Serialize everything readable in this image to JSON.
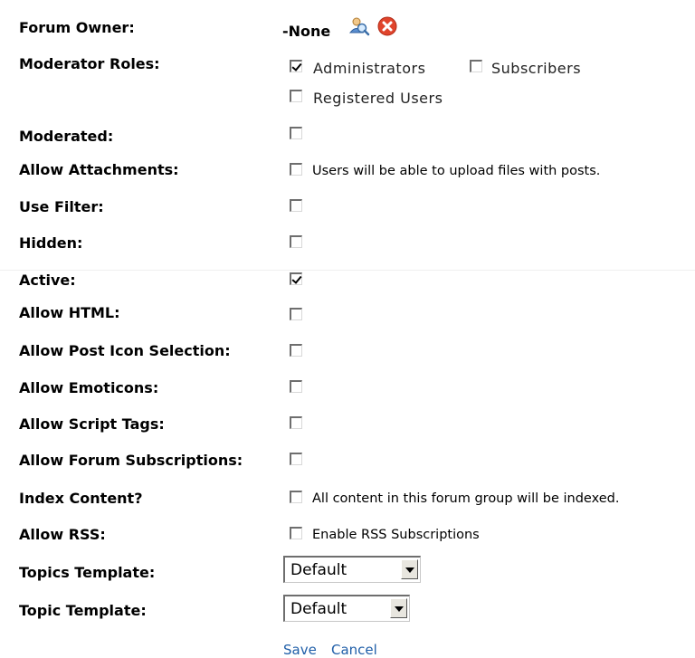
{
  "form": {
    "forum_owner": {
      "label": "Forum Owner:",
      "value": "-None"
    },
    "moderator_roles": {
      "label": "Moderator Roles:",
      "options": [
        {
          "label": "Administrators",
          "checked": true
        },
        {
          "label": "Subscribers",
          "checked": false
        },
        {
          "label": "Registered Users",
          "checked": false
        }
      ]
    },
    "moderated": {
      "label": "Moderated:",
      "checked": false
    },
    "allow_attachments": {
      "label": "Allow Attachments:",
      "checked": false,
      "description": "Users will be able to upload files with posts."
    },
    "use_filter": {
      "label": "Use Filter:",
      "checked": false
    },
    "hidden": {
      "label": "Hidden:",
      "checked": false
    },
    "active": {
      "label": "Active:",
      "checked": true
    },
    "allow_html": {
      "label": "Allow HTML:",
      "checked": false
    },
    "allow_post_icon_selection": {
      "label": "Allow Post Icon Selection:",
      "checked": false
    },
    "allow_emoticons": {
      "label": "Allow Emoticons:",
      "checked": false
    },
    "allow_script_tags": {
      "label": "Allow Script Tags:",
      "checked": false
    },
    "allow_forum_subscriptions": {
      "label": "Allow Forum Subscriptions:",
      "checked": false
    },
    "index_content": {
      "label": "Index Content?",
      "checked": false,
      "description": "All content in this forum group will be indexed."
    },
    "allow_rss": {
      "label": "Allow RSS:",
      "checked": false,
      "description": "Enable RSS Subscriptions"
    },
    "topics_template": {
      "label": "Topics Template:",
      "selected": "Default"
    },
    "topic_template": {
      "label": "Topic Template:",
      "selected": "Default"
    }
  },
  "actions": {
    "save_label": "Save",
    "cancel_label": "Cancel"
  },
  "icons": {
    "owner_search": "user-search-icon",
    "owner_clear": "clear-icon"
  },
  "colors": {
    "link": "#1f5ea8",
    "clear_icon": "#e0442c"
  }
}
